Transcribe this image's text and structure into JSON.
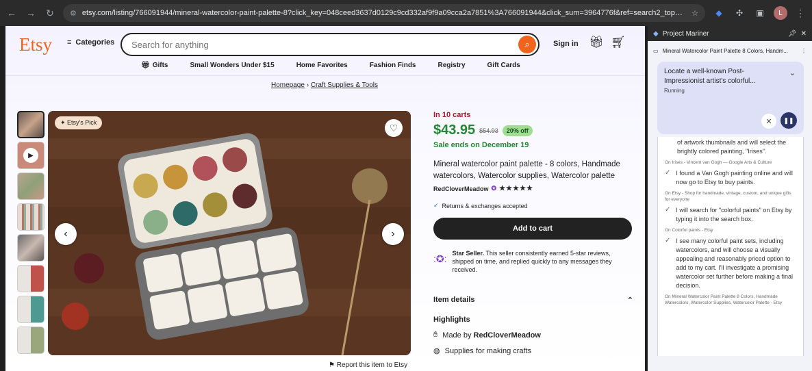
{
  "browser": {
    "url": "etsy.com/listing/766091944/mineral-watercolor-paint-palette-8?click_key=048ceed3637d0129c9cd332af9f9a09cca2a7851%3A766091944&click_sum=3964776f&ref=search2_top_narrowing_intent..."
  },
  "header": {
    "logo": "Etsy",
    "categories": "Categories",
    "search_placeholder": "Search for anything",
    "sign_in": "Sign in"
  },
  "subnav": [
    "Gifts",
    "Small Wonders Under $15",
    "Home Favorites",
    "Fashion Finds",
    "Registry",
    "Gift Cards"
  ],
  "breadcrumb": {
    "home": "Homepage",
    "sep": " › ",
    "cat": "Craft Supplies & Tools"
  },
  "gallery": {
    "pick_badge": "Etsy's Pick",
    "report": "Report this item to Etsy"
  },
  "product": {
    "in_carts": "In 10 carts",
    "price": "$43.95",
    "old_price": "$54.93",
    "discount": "20% off",
    "sale_ends": "Sale ends on December 19",
    "title": "Mineral watercolor paint palette - 8 colors, Handmade watercolors, Watercolor supplies, Watercolor palette",
    "shop": "RedCloverMeadow",
    "stars": "★★★★★",
    "returns": "Returns & exchanges accepted",
    "add_to_cart": "Add to cart",
    "star_seller_bold": "Star Seller.",
    "star_seller_text": " This seller consistently earned 5-star reviews, shipped on time, and replied quickly to any messages they received.",
    "item_details": "Item details",
    "highlights": "Highlights",
    "made_by_prefix": "Made by ",
    "made_by": "RedCloverMeadow",
    "supplies": "Supplies for making crafts"
  },
  "sidepanel": {
    "title": "Project Mariner",
    "tab_title": "Mineral Watercolor Paint Palette 8 Colors, Handm...",
    "task": "Locate a well-known Post-Impressionist artist's colorful...",
    "status": "Running",
    "log": {
      "partial": "of artwork thumbnails and will select the brightly colored painting, \"Irises\".",
      "src1": "On Irises - Vincent van Gogh — Google Arts & Culture",
      "step1": "I found a Van Gogh painting online and will now go to Etsy to buy paints.",
      "src2": "On Etsy - Shop for handmade, vintage, custom, and unique gifts for everyone",
      "step2": "I will search for \"colorful paints\" on Etsy by typing it into the search box.",
      "src3": "On Colorful paints - Etsy",
      "step3": "I see many colorful paint sets, including watercolors, and will choose a visually appealing and reasonably priced option to add to my cart. I'll investigate a promising watercolor set further before making a final decision.",
      "src4": "On Mineral Watercolor Paint Palette 8 Colors, Handmade Watercolors, Watercolor Supplies, Watercolor Palette - Etsy"
    }
  },
  "colors": {
    "etsy_orange": "#f1641e",
    "sale_green": "#258635",
    "carts_red": "#a61a2e"
  }
}
